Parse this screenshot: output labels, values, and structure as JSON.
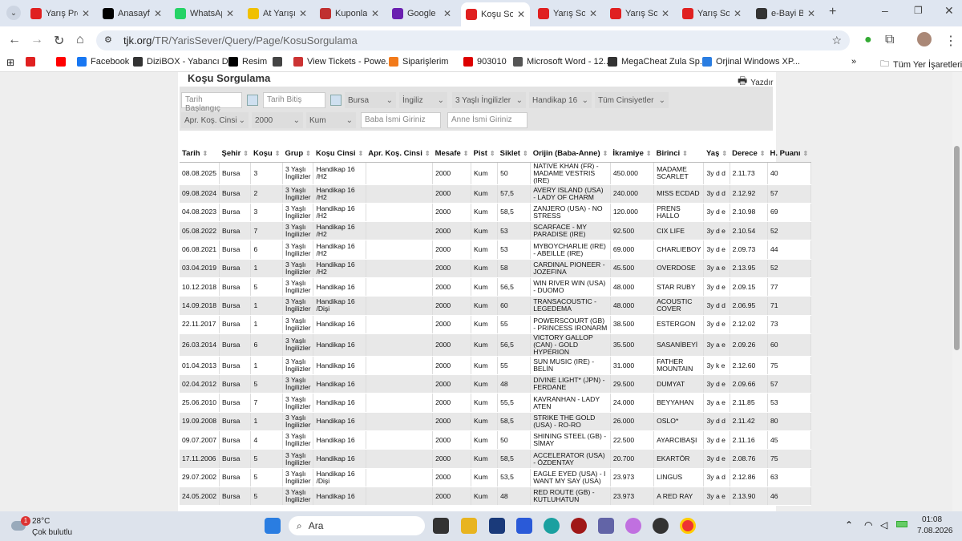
{
  "tabs": [
    {
      "title": "Yarış Pro",
      "color": "#e02020"
    },
    {
      "title": "Anasayfa",
      "color": "#000"
    },
    {
      "title": "WhatsApp",
      "color": "#25d366"
    },
    {
      "title": "At Yarışı",
      "color": "#f0c000"
    },
    {
      "title": "Kuponlar",
      "color": "#c03030"
    },
    {
      "title": "Google",
      "color": "#6a1fb0"
    },
    {
      "title": "Koşu Sor",
      "color": "#e02020"
    },
    {
      "title": "Yarış Sor",
      "color": "#e02020"
    },
    {
      "title": "Yarış Sor",
      "color": "#e02020"
    },
    {
      "title": "Yarış Sor",
      "color": "#e02020"
    },
    {
      "title": "e-Bayi B",
      "color": "#333"
    }
  ],
  "url": {
    "host": "tjk.org",
    "path": "/TR/YarisSever/Query/Page/KosuSorgulama"
  },
  "bookmarks": [
    {
      "label": "",
      "color": "#e02020"
    },
    {
      "label": "",
      "color": "#ff0000"
    },
    {
      "label": "Facebook",
      "color": "#1877f2"
    },
    {
      "label": "DiziBOX - Yabancı D...",
      "color": "#333"
    },
    {
      "label": "Resim",
      "color": "#000"
    },
    {
      "label": "",
      "color": "#444"
    },
    {
      "label": "View Tickets - Powe...",
      "color": "#c33"
    },
    {
      "label": "Siparişlerim",
      "color": "#f27a1a"
    },
    {
      "label": "903010",
      "color": "#d00"
    },
    {
      "label": "Microsoft Word - 12...",
      "color": "#555"
    },
    {
      "label": "MegaCheat Zula Sp...",
      "color": "#333"
    },
    {
      "label": "Orjinal Windows XP...",
      "color": "#2a7de1"
    }
  ],
  "bookmarks_folder": "Tüm Yer İşaretleri",
  "page": {
    "title": "Koşu Sorgulama",
    "print": "Yazdır"
  },
  "filters": {
    "start_date": "Tarih Başlangıç",
    "end_date": "Tarih Bitiş",
    "city": "Bursa",
    "breed": "İngiliz",
    "group": "3 Yaşlı İngilizler",
    "race_type": "Handikap 16",
    "gender": "Tüm Cinsiyetler",
    "apr_type": "Apr. Koş. Cinsi",
    "distance": "2000",
    "track": "Kum",
    "father": "Baba İsmi Giriniz",
    "mother": "Anne İsmi Giriniz"
  },
  "columns": [
    "Tarih",
    "Şehir",
    "Koşu",
    "Grup",
    "Koşu Cinsi",
    "Apr. Koş. Cinsi",
    "Mesafe",
    "Pist",
    "Siklet",
    "Orijin (Baba-Anne)",
    "İkramiye",
    "Birinci",
    "Yaş",
    "Derece",
    "H. Puanı"
  ],
  "rows": [
    [
      "08.08.2025",
      "Bursa",
      "3",
      "3 Yaşlı İngilizler",
      "Handikap 16 /H2",
      "",
      "2000",
      "Kum",
      "50",
      "NATIVE KHAN (FR) - MADAME VESTRIS (IRE)",
      "450.000",
      "MADAME SCARLET",
      "3y d d",
      "2.11.73",
      "40"
    ],
    [
      "09.08.2024",
      "Bursa",
      "2",
      "3 Yaşlı İngilizler",
      "Handikap 16 /H2",
      "",
      "2000",
      "Kum",
      "57,5",
      "AVERY ISLAND (USA) - LADY OF CHARM",
      "240.000",
      "MISS ECDAD",
      "3y d d",
      "2.12.92",
      "57"
    ],
    [
      "04.08.2023",
      "Bursa",
      "3",
      "3 Yaşlı İngilizler",
      "Handikap 16 /H2",
      "",
      "2000",
      "Kum",
      "58,5",
      "ZANJERO (USA) - NO STRESS",
      "120.000",
      "PRENS HALLO",
      "3y d e",
      "2.10.98",
      "69"
    ],
    [
      "05.08.2022",
      "Bursa",
      "7",
      "3 Yaşlı İngilizler",
      "Handikap 16 /H2",
      "",
      "2000",
      "Kum",
      "53",
      "SCARFACE - MY PARADISE (IRE)",
      "92.500",
      "CIX LIFE",
      "3y d e",
      "2.10.54",
      "52"
    ],
    [
      "06.08.2021",
      "Bursa",
      "6",
      "3 Yaşlı İngilizler",
      "Handikap 16 /H2",
      "",
      "2000",
      "Kum",
      "53",
      "MYBOYCHARLIE (IRE) - ABEILLE (IRE)",
      "69.000",
      "CHARLIEBOY",
      "3y d e",
      "2.09.73",
      "44"
    ],
    [
      "03.04.2019",
      "Bursa",
      "1",
      "3 Yaşlı İngilizler",
      "Handikap 16 /H2",
      "",
      "2000",
      "Kum",
      "58",
      "CARDINAL PIONEER - JOZEFINA",
      "45.500",
      "OVERDOSE",
      "3y a e",
      "2.13.95",
      "52"
    ],
    [
      "10.12.2018",
      "Bursa",
      "5",
      "3 Yaşlı İngilizler",
      "Handikap 16",
      "",
      "2000",
      "Kum",
      "56,5",
      "WIN RIVER WIN (USA) - DUOMO",
      "48.000",
      "STAR RUBY",
      "3y d e",
      "2.09.15",
      "77"
    ],
    [
      "14.09.2018",
      "Bursa",
      "1",
      "3 Yaşlı İngilizler",
      "Handikap 16 /Dişi",
      "",
      "2000",
      "Kum",
      "60",
      "TRANSACOUSTIC - LEGEDEMA",
      "48.000",
      "ACOUSTIC COVER",
      "3y d d",
      "2.06.95",
      "71"
    ],
    [
      "22.11.2017",
      "Bursa",
      "1",
      "3 Yaşlı İngilizler",
      "Handikap 16",
      "",
      "2000",
      "Kum",
      "55",
      "POWERSCOURT (GB) - PRINCESS IRONARM",
      "38.500",
      "ESTERGON",
      "3y d e",
      "2.12.02",
      "73"
    ],
    [
      "26.03.2014",
      "Bursa",
      "6",
      "3 Yaşlı İngilizler",
      "Handikap 16",
      "",
      "2000",
      "Kum",
      "56,5",
      "VICTORY GALLOP (CAN) - GOLD HYPERION",
      "35.500",
      "SASANİBEYİ",
      "3y a e",
      "2.09.26",
      "60"
    ],
    [
      "01.04.2013",
      "Bursa",
      "1",
      "3 Yaşlı İngilizler",
      "Handikap 16",
      "",
      "2000",
      "Kum",
      "55",
      "SUN MUSIC (IRE) - BELİN",
      "31.000",
      "FATHER MOUNTAIN",
      "3y k e",
      "2.12.60",
      "75"
    ],
    [
      "02.04.2012",
      "Bursa",
      "5",
      "3 Yaşlı İngilizler",
      "Handikap 16",
      "",
      "2000",
      "Kum",
      "48",
      "DIVINE LIGHT* (JPN) - FERDANE",
      "29.500",
      "DUMYAT",
      "3y d e",
      "2.09.66",
      "57"
    ],
    [
      "25.06.2010",
      "Bursa",
      "7",
      "3 Yaşlı İngilizler",
      "Handikap 16",
      "",
      "2000",
      "Kum",
      "55,5",
      "KAVRANHAN - LADY ATEN",
      "24.000",
      "BEYYAHAN",
      "3y a e",
      "2.11.85",
      "53"
    ],
    [
      "19.09.2008",
      "Bursa",
      "1",
      "3 Yaşlı İngilizler",
      "Handikap 16",
      "",
      "2000",
      "Kum",
      "58,5",
      "STRIKE THE GOLD (USA) - RO-RO",
      "26.000",
      "OSLO*",
      "3y d d",
      "2.11.42",
      "80"
    ],
    [
      "09.07.2007",
      "Bursa",
      "4",
      "3 Yaşlı İngilizler",
      "Handikap 16",
      "",
      "2000",
      "Kum",
      "50",
      "SHINING STEEL (GB) - SİMAY",
      "22.500",
      "AYARCIBAŞI",
      "3y d e",
      "2.11.16",
      "45"
    ],
    [
      "17.11.2006",
      "Bursa",
      "5",
      "3 Yaşlı İngilizler",
      "Handikap 16",
      "",
      "2000",
      "Kum",
      "58,5",
      "ACCELERATOR (USA) - ÖZDENTAY",
      "20.700",
      "EKARTÖR",
      "3y d e",
      "2.08.76",
      "75"
    ],
    [
      "29.07.2002",
      "Bursa",
      "5",
      "3 Yaşlı İngilizler",
      "Handikap 16 /Dişi",
      "",
      "2000",
      "Kum",
      "53,5",
      "EAGLE EYED (USA) - I WANT MY SAY (USA)",
      "23.973",
      "LINGUS",
      "3y a d",
      "2.12.86",
      "63"
    ],
    [
      "24.05.2002",
      "Bursa",
      "5",
      "3 Yaşlı İngilizler",
      "Handikap 16",
      "",
      "2000",
      "Kum",
      "48",
      "RED ROUTE (GB) - KUTLUHATUN",
      "23.973",
      "A RED RAY",
      "3y a e",
      "2.13.90",
      "46"
    ]
  ],
  "taskbar": {
    "temp": "28°C",
    "weather": "Çok bulutlu",
    "search": "Ara",
    "time": "01:08",
    "date": "7.08.2026",
    "badge": "1"
  }
}
